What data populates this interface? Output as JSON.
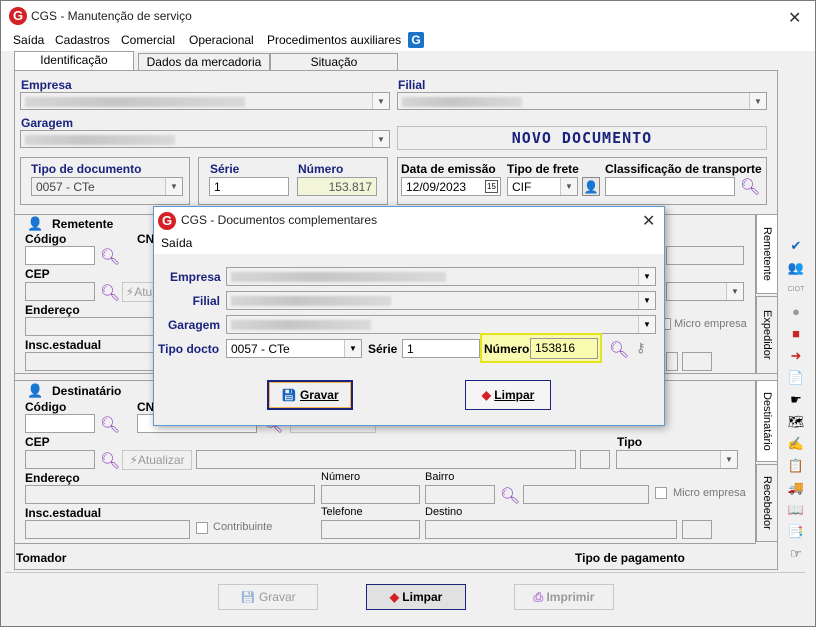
{
  "window": {
    "title": "CGS - Manutenção de serviço",
    "logo": "G",
    "close": "✕"
  },
  "menu": [
    "Saída",
    "Cadastros",
    "Comercial",
    "Operacional",
    "Procedimentos auxiliares"
  ],
  "tabs": [
    "Identificação",
    "Dados da mercadoria",
    "Situação"
  ],
  "form": {
    "empresa_label": "Empresa",
    "filial_label": "Filial",
    "garagem_label": "Garagem",
    "novo_documento": "NOVO DOCUMENTO",
    "tipo_doc_label": "Tipo de documento",
    "tipo_doc_value": "0057 - CTe",
    "serie_label": "Série",
    "serie_value": "1",
    "numero_label": "Número",
    "numero_value": "153.817",
    "data_emissao_label": "Data de emissão",
    "data_emissao_value": "12/09/2023",
    "calendar_day": "15",
    "tipo_frete_label": "Tipo de frete",
    "tipo_frete_value": "CIF",
    "classif_label": "Classificação de transporte"
  },
  "remetente": {
    "title": "Remetente",
    "codigo": "Código",
    "cnpj": "CN",
    "cep": "CEP",
    "atualizar": "Atu",
    "endereco": "Endereço",
    "insc": "Insc.estadual",
    "micro": "Micro empresa"
  },
  "destinatario": {
    "title": "Destinatário",
    "codigo": "Código",
    "cnpj": "CN",
    "cep": "CEP",
    "atualizar": "Atualizar",
    "tipo": "Tipo",
    "endereco": "Endereço",
    "numero": "Número",
    "bairro": "Bairro",
    "micro": "Micro empresa",
    "insc": "Insc.estadual",
    "contribuinte": "Contribuinte",
    "telefone": "Telefone",
    "destino": "Destino"
  },
  "vtabs": [
    "Remetente",
    "Expedidor",
    "Destinatário",
    "Recebedor"
  ],
  "footer": {
    "tomador": "Tomador",
    "tipo_pagamento": "Tipo de pagamento"
  },
  "buttons": {
    "gravar": "Gravar",
    "limpar": "Limpar",
    "imprimir": "Imprimir"
  },
  "dialog": {
    "title": "CGS - Documentos complementares",
    "menu": "Saída",
    "empresa": "Empresa",
    "filial": "Filial",
    "garagem": "Garagem",
    "tipo_docto": "Tipo docto",
    "tipo_docto_value": "0057 - CTe",
    "serie": "Série",
    "serie_value": "1",
    "numero": "Número",
    "numero_value": "153816",
    "gravar": "Gravar",
    "limpar": "Limpar"
  }
}
